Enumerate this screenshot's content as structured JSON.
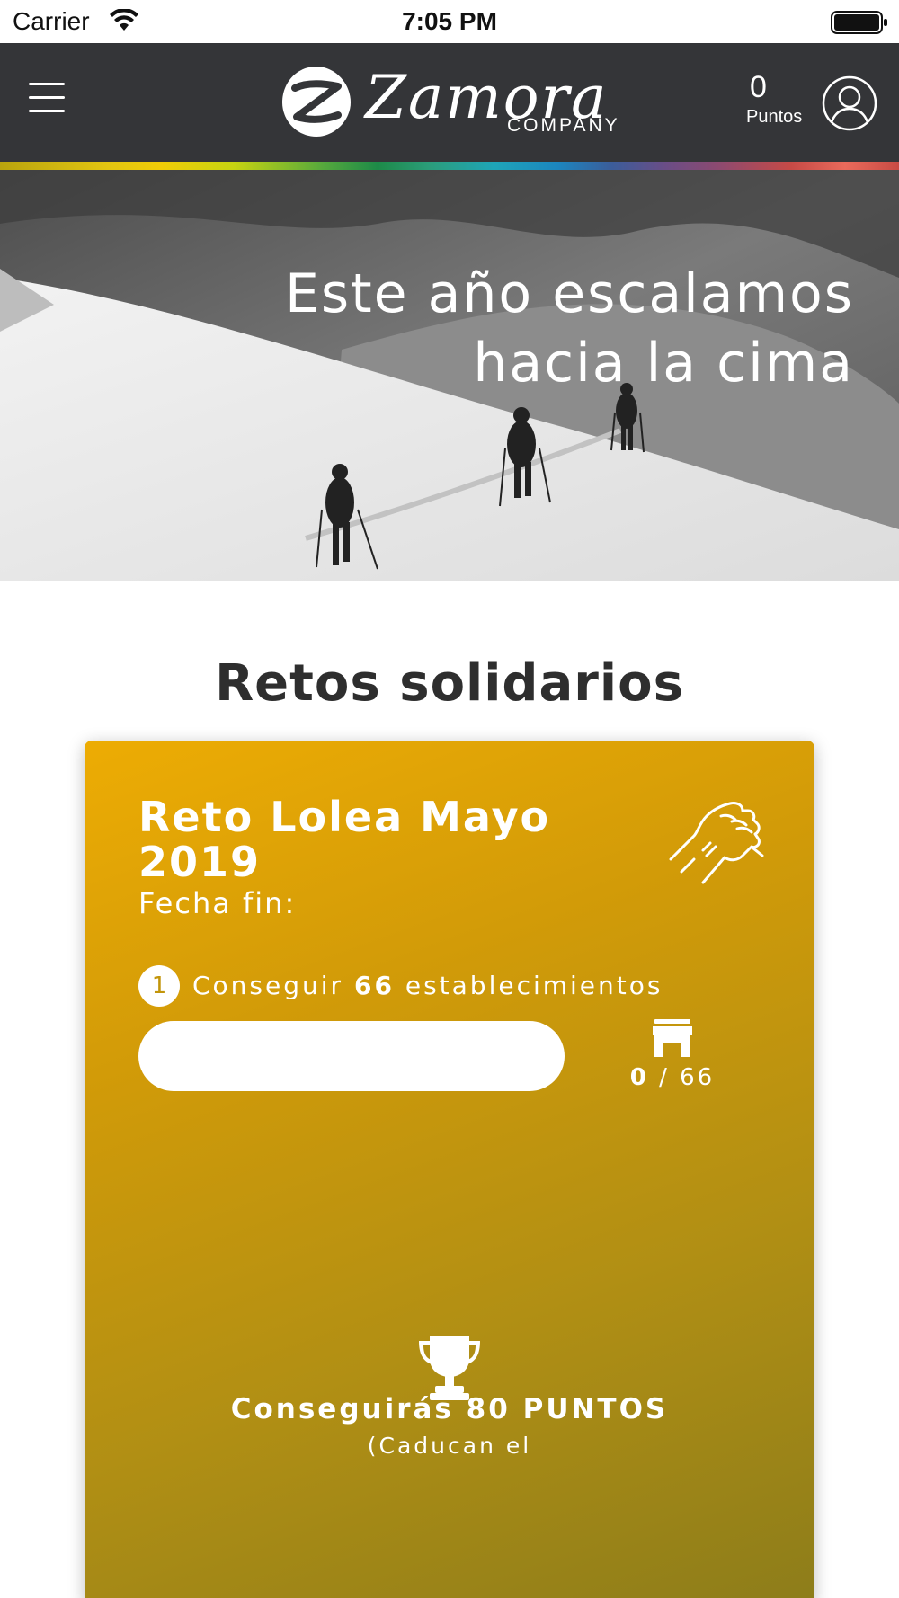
{
  "status_bar": {
    "carrier": "Carrier",
    "time": "7:05 PM"
  },
  "header": {
    "logo_word": "Zamora",
    "logo_sub": "COMPANY",
    "points_value": "0",
    "points_label": "Puntos",
    "icons": {
      "menu": "hamburger-menu-icon",
      "avatar": "user-avatar-icon",
      "logo": "zamora-logo"
    }
  },
  "hero": {
    "title_line1": "Este año escalamos",
    "title_line2": "hacia la cima"
  },
  "section": {
    "title": "Retos solidarios"
  },
  "challenge": {
    "title": "Reto Lolea Mayo 2019",
    "date_label": "Fecha fin:",
    "step_number": "1",
    "step_prefix": "Conseguir",
    "step_count": "66",
    "step_suffix": "establecimientos",
    "progress_current": "0",
    "progress_separator": " / ",
    "progress_total": "66",
    "progress_fraction": 0,
    "reward": "Conseguirás 80 PUNTOS",
    "expiry": "(Caducan el",
    "icons": {
      "challenge": "handshake-icon",
      "progress": "store-icon",
      "reward": "trophy-icon"
    },
    "colors": {
      "card_start": "#edac04",
      "card_end": "#8d7d1a"
    }
  }
}
